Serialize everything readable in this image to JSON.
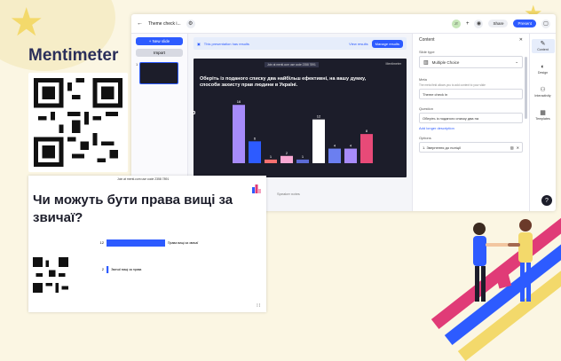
{
  "brand": {
    "name": "Mentimeter"
  },
  "topbar": {
    "back_icon": "arrow-left-icon",
    "presentation_title": "Theme check i...",
    "add_label": "+",
    "share_label": "Share",
    "present_label": "Present"
  },
  "left_panel": {
    "new_slide_label": "+ New slide",
    "import_label": "Import",
    "slides": [
      {
        "number": "1"
      }
    ]
  },
  "results_banner": {
    "message": "This presentation has results",
    "view_label": "View results",
    "manage_label": "Manage results"
  },
  "slide_preview": {
    "join_text": "Join at menti.com use code 2358 7891",
    "logo_text": "Mentimeter",
    "question": "Оберіть із поданого списку два найбільш ефективні, на вашу думку, способи захисту прав людини в Україні.",
    "watermark": "b"
  },
  "chart_data": {
    "type": "bar",
    "values": [
      16,
      6,
      1,
      2,
      1,
      12,
      4,
      4,
      8
    ],
    "colors": [
      "#a78bfa",
      "#2d5bff",
      "#f87171",
      "#f9a8d4",
      "#5b6bd6",
      "#ffffff",
      "#6b7ff0",
      "#a78bfa",
      "#e84a78"
    ],
    "ylim": [
      0,
      18
    ]
  },
  "speaker_notes_label": "Speaker notes",
  "right_panel": {
    "header": "Content",
    "close_icon": "close-icon",
    "slide_type_label": "Slide type",
    "slide_type_value": "Multiple Choice",
    "meta_label": "Meta",
    "meta_help": "The meta field allows you to add context to your slide",
    "meta_value": "Theme check in",
    "question_label": "Question",
    "question_value": "Оберіть із поданого списку два на",
    "add_longer_label": "Add longer description",
    "options_label": "Options",
    "option1_value": "1. Звернення до поліції"
  },
  "side_tabs": [
    {
      "label": "Content",
      "icon": "pencil-icon"
    },
    {
      "label": "Design",
      "icon": "palette-icon"
    },
    {
      "label": "Interactivity",
      "icon": "user-icon"
    },
    {
      "label": "Templates",
      "icon": "grid-icon"
    }
  ],
  "help_label": "?",
  "slide2": {
    "join_text": "Join at menti.com use code 2358 7891",
    "title": "Чи можуть бути права вищі за звичаї?",
    "bars": [
      {
        "count": "12",
        "label": "Права вищі за звичаї",
        "value": 12,
        "color": "#2d5bff"
      },
      {
        "count": "2",
        "label": "Звичаї вищі за права",
        "value": 0.4,
        "color": "#2d5bff"
      }
    ]
  }
}
